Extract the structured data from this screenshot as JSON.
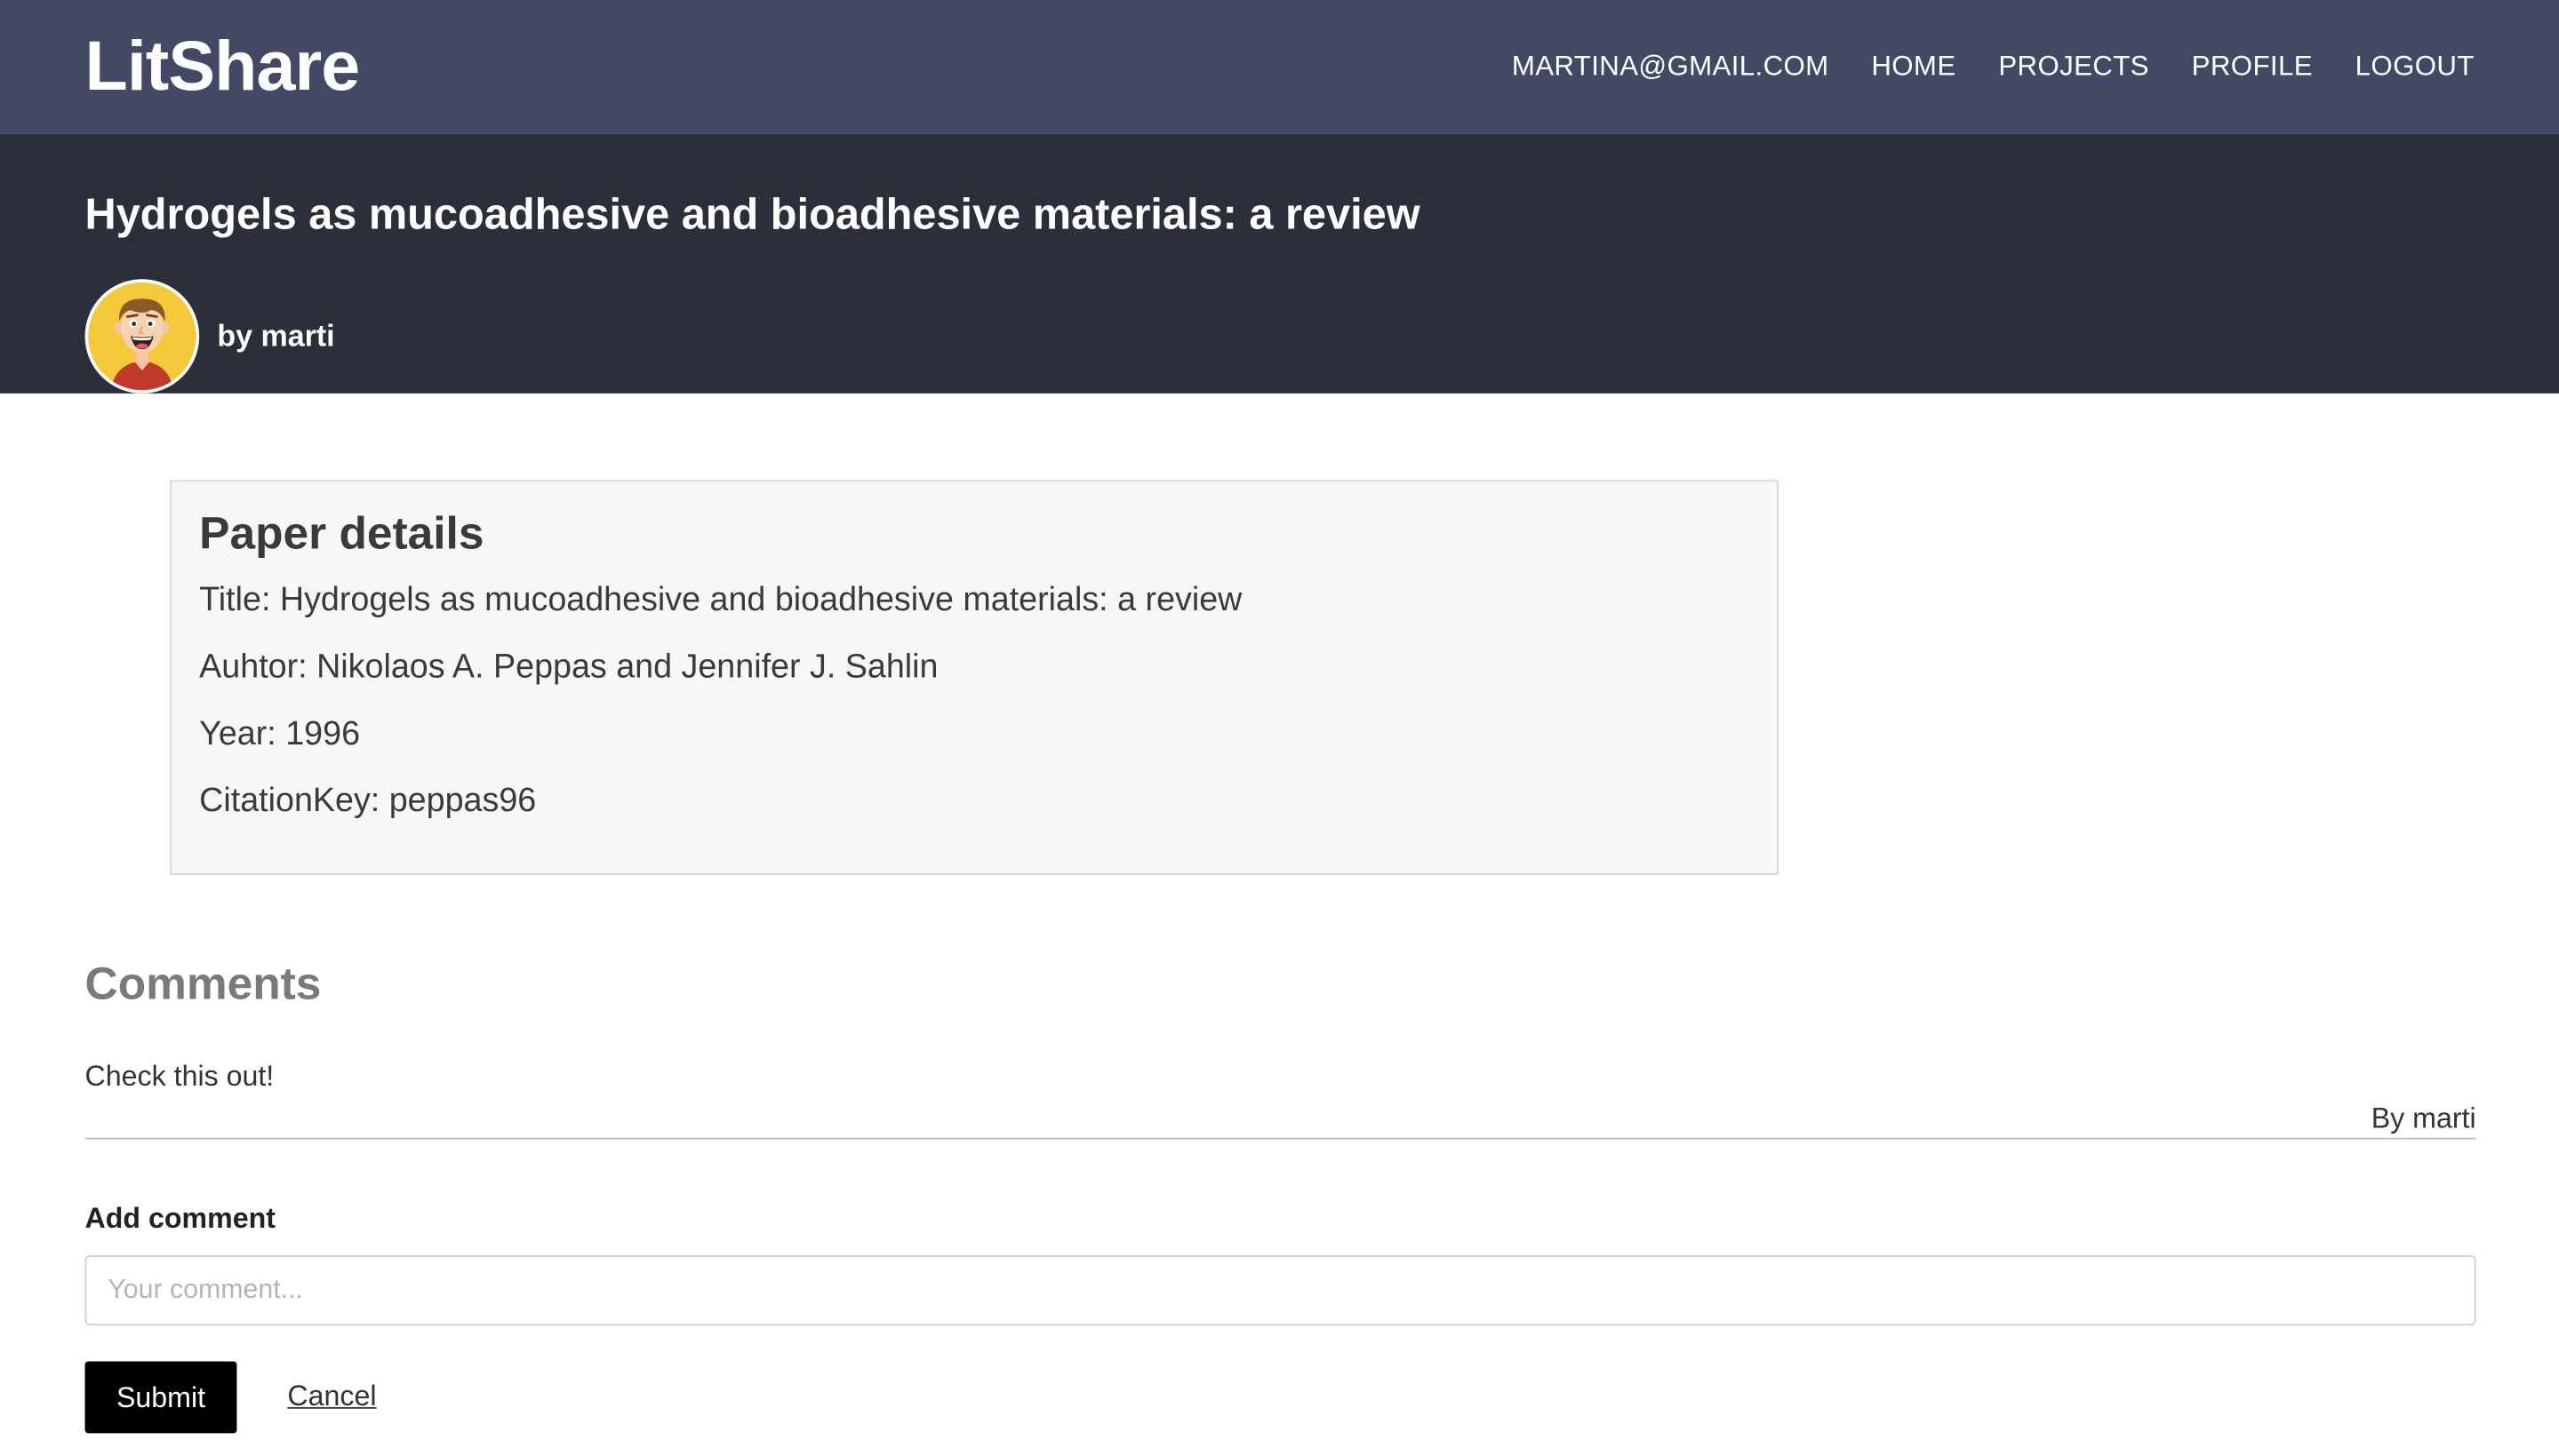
{
  "nav": {
    "brand": "LitShare",
    "links": [
      {
        "label": "MARTINA@GMAIL.COM"
      },
      {
        "label": "HOME"
      },
      {
        "label": "PROJECTS"
      },
      {
        "label": "PROFILE"
      },
      {
        "label": "LOGOUT"
      }
    ]
  },
  "header": {
    "title": "Hydrogels as mucoadhesive and bioadhesive materials: a review",
    "byline": "by marti"
  },
  "details": {
    "heading": "Paper details",
    "title_line": "Title: Hydrogels as mucoadhesive and bioadhesive materials: a review",
    "author_line": "Auhtor: Nikolaos A. Peppas and Jennifer J. Sahlin",
    "year_line": "Year: 1996",
    "citation_line": "CitationKey: peppas96"
  },
  "comments": {
    "heading": "Comments",
    "items": [
      {
        "text": "Check this out!",
        "author": "By marti"
      }
    ]
  },
  "form": {
    "label": "Add comment",
    "placeholder": "Your comment...",
    "value": "",
    "submit_label": "Submit",
    "cancel_label": "Cancel"
  },
  "colors": {
    "navbar": "#434964",
    "header_band": "#2b2f39",
    "avatar_bg": "#f3c93a",
    "submit_bg": "#000000"
  }
}
